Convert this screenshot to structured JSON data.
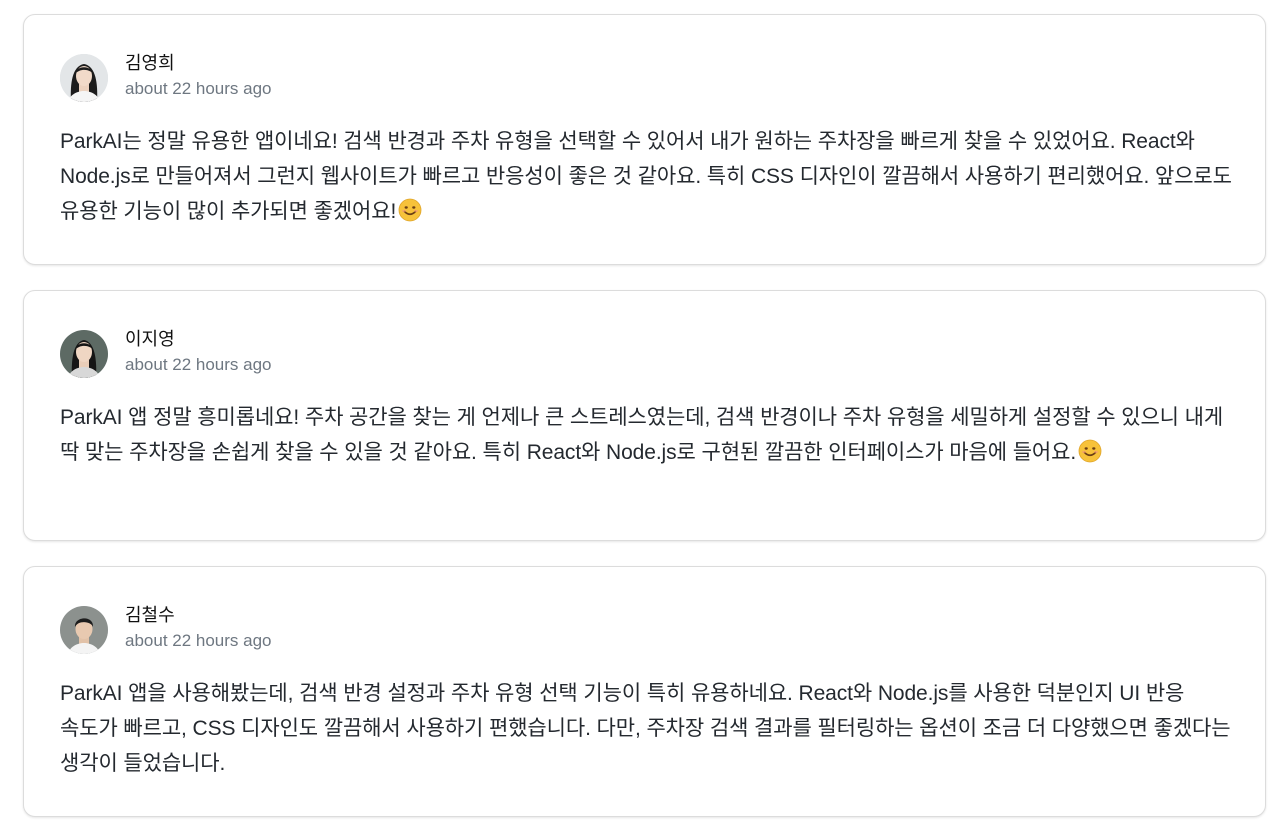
{
  "reviews": [
    {
      "author": "김영희",
      "time": "about 22 hours ago",
      "avatar_icon": "female-avatar-icon",
      "text": "ParkAI는 정말 유용한 앱이네요! 검색 반경과 주차 유형을 선택할 수 있어서 내가 원하는 주차장을 빠르게 찾을 수 있었어요. React와 Node.js로 만들어져서 그런지 웹사이트가 빠르고 반응성이 좋은 것 같아요. 특히 CSS 디자인이 깔끔해서 사용하기 편리했어요. 앞으로도 유용한 기능이 많이 추가되면 좋겠어요!",
      "emoji": "smiling-face-emoji"
    },
    {
      "author": "이지영",
      "time": "about 22 hours ago",
      "avatar_icon": "female-avatar-icon",
      "text": "ParkAI 앱 정말 흥미롭네요! 주차 공간을 찾는 게 언제나 큰 스트레스였는데, 검색 반경이나 주차 유형을 세밀하게 설정할 수 있으니 내게 딱 맞는 주차장을 손쉽게 찾을 수 있을 것 같아요. 특히 React와 Node.js로 구현된 깔끔한 인터페이스가 마음에 들어요.",
      "emoji": "smiling-face-emoji"
    },
    {
      "author": "김철수",
      "time": "about 22 hours ago",
      "avatar_icon": "male-avatar-icon",
      "text": "ParkAI 앱을 사용해봤는데, 검색 반경 설정과 주차 유형 선택 기능이 특히 유용하네요. React와 Node.js를 사용한 덕분인지 UI 반응 속도가 빠르고, CSS 디자인도 깔끔해서 사용하기 편했습니다. 다만, 주차장 검색 결과를 필터링하는 옵션이 조금 더 다양했으면 좋겠다는 생각이 들었습니다.",
      "emoji": ""
    }
  ],
  "colors": {
    "card_border": "#dcdcdc",
    "muted_text": "#6e7781",
    "body_text": "#24292f",
    "emoji_yellow": "#f7c23a"
  }
}
